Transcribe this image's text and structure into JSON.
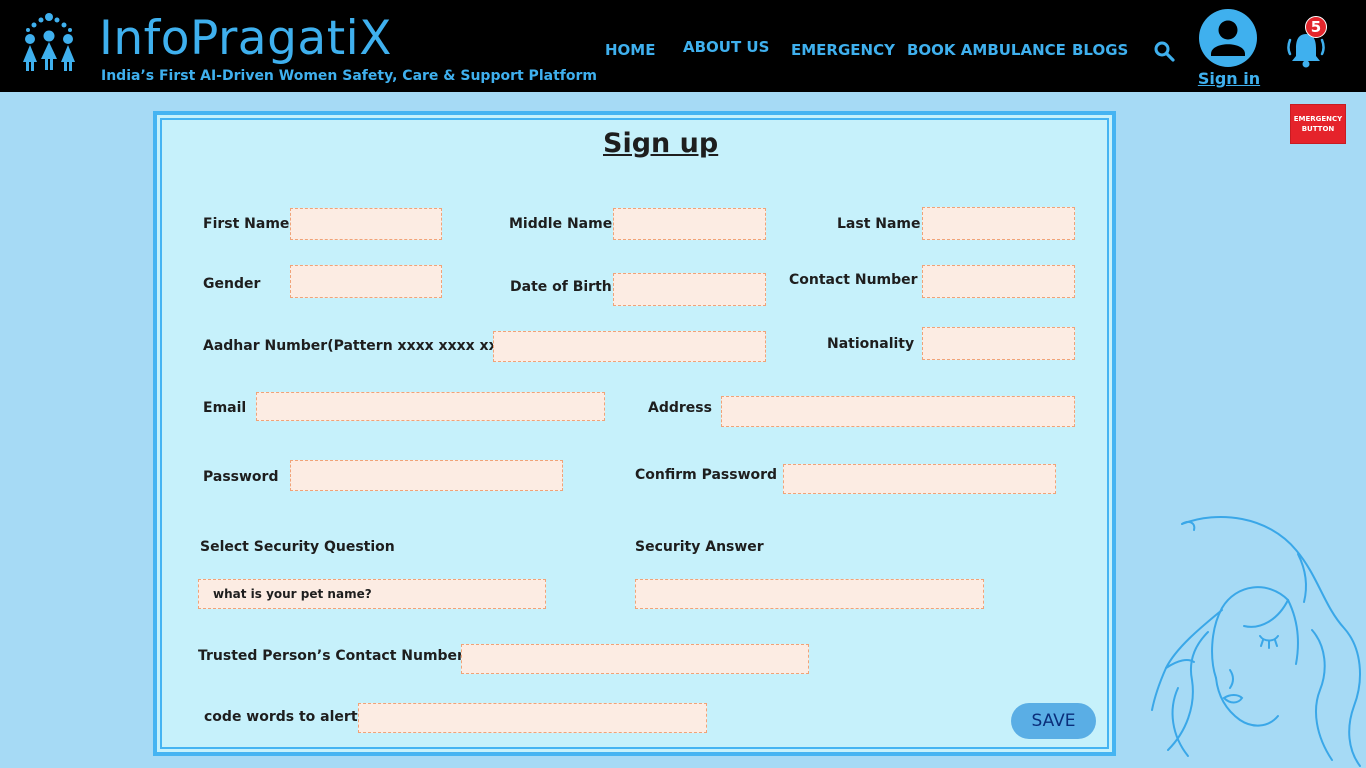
{
  "header": {
    "logo_text": "InfoPragatiX",
    "tagline": "India’s First AI-Driven Women Safety, Care & Support Platform",
    "nav": {
      "home": "HOME",
      "about": "ABOUT US",
      "emergency": "EMERGENCY",
      "book_ambulance": "BOOK AMBULANCE",
      "blogs": "BLOGS"
    },
    "signin_label": "Sign in",
    "notification_count": "5",
    "icons": [
      "women-group-logo-icon",
      "search-icon",
      "user-avatar-icon",
      "bell-icon"
    ]
  },
  "emergency_button": {
    "line1": "EMERGENCY",
    "line2": "BUTTON"
  },
  "form": {
    "title": "Sign up",
    "labels": {
      "first_name": "First Name",
      "middle_name": "Middle Name",
      "last_name": "Last Name",
      "gender": "Gender",
      "dob": "Date of Birth",
      "contact_number": "Contact Number",
      "aadhar": "Aadhar Number(Pattern xxxx xxxx xxxx)",
      "nationality": "Nationality",
      "email": "Email",
      "address": "Address",
      "password": "Password",
      "confirm_password": "Confirm Password",
      "security_question": "Select Security Question",
      "security_answer": "Security Answer",
      "trusted_contact": "Trusted Person’s Contact Number",
      "code_words": "code words to alert"
    },
    "values": {
      "first_name": "",
      "middle_name": "",
      "last_name": "",
      "gender": "",
      "dob": "",
      "contact_number": "",
      "aadhar": "",
      "nationality": "",
      "email": "",
      "address": "",
      "password": "",
      "confirm_password": "",
      "security_question": "what is your pet name?",
      "security_answer": "",
      "trusted_contact": "",
      "code_words": ""
    },
    "save_label": "SAVE"
  },
  "colors": {
    "header_bg": "#000000",
    "accent": "#3fb0ee",
    "page_bg": "#a6daf5",
    "panel_bg": "#c6f1fb",
    "field_bg": "#fcece3",
    "field_border": "#f0a378",
    "emergency_red": "#e5232b",
    "save_bg": "#5aaee5"
  }
}
